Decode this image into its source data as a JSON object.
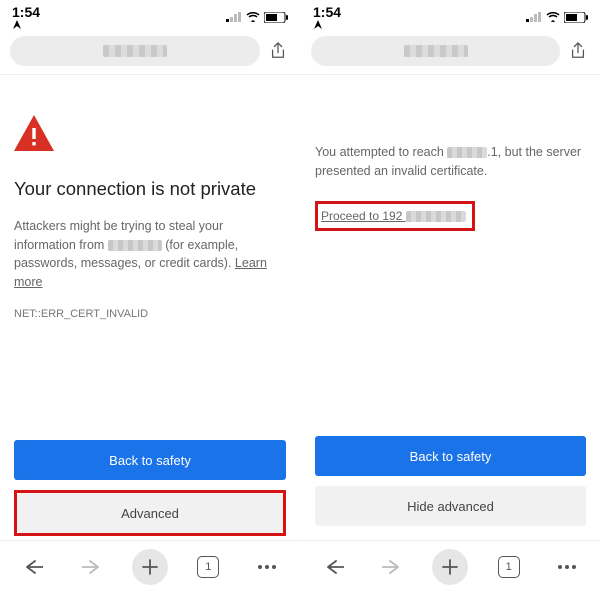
{
  "status": {
    "time": "1:54",
    "tab_count": "1"
  },
  "left": {
    "heading": "Your connection is not private",
    "body_a": "Attackers might be trying to steal your information from ",
    "body_b": " (for example, passwords, messages, or credit cards). ",
    "learn_more": "Learn more",
    "error_code": "NET::ERR_CERT_INVALID",
    "back_btn": "Back to safety",
    "advanced_btn": "Advanced"
  },
  "right": {
    "body_a": "You attempted to reach ",
    "body_b": ".1, but the server presented an invalid certificate.",
    "proceed_prefix": "Proceed to 192",
    "back_btn": "Back to safety",
    "hide_btn": "Hide advanced"
  }
}
